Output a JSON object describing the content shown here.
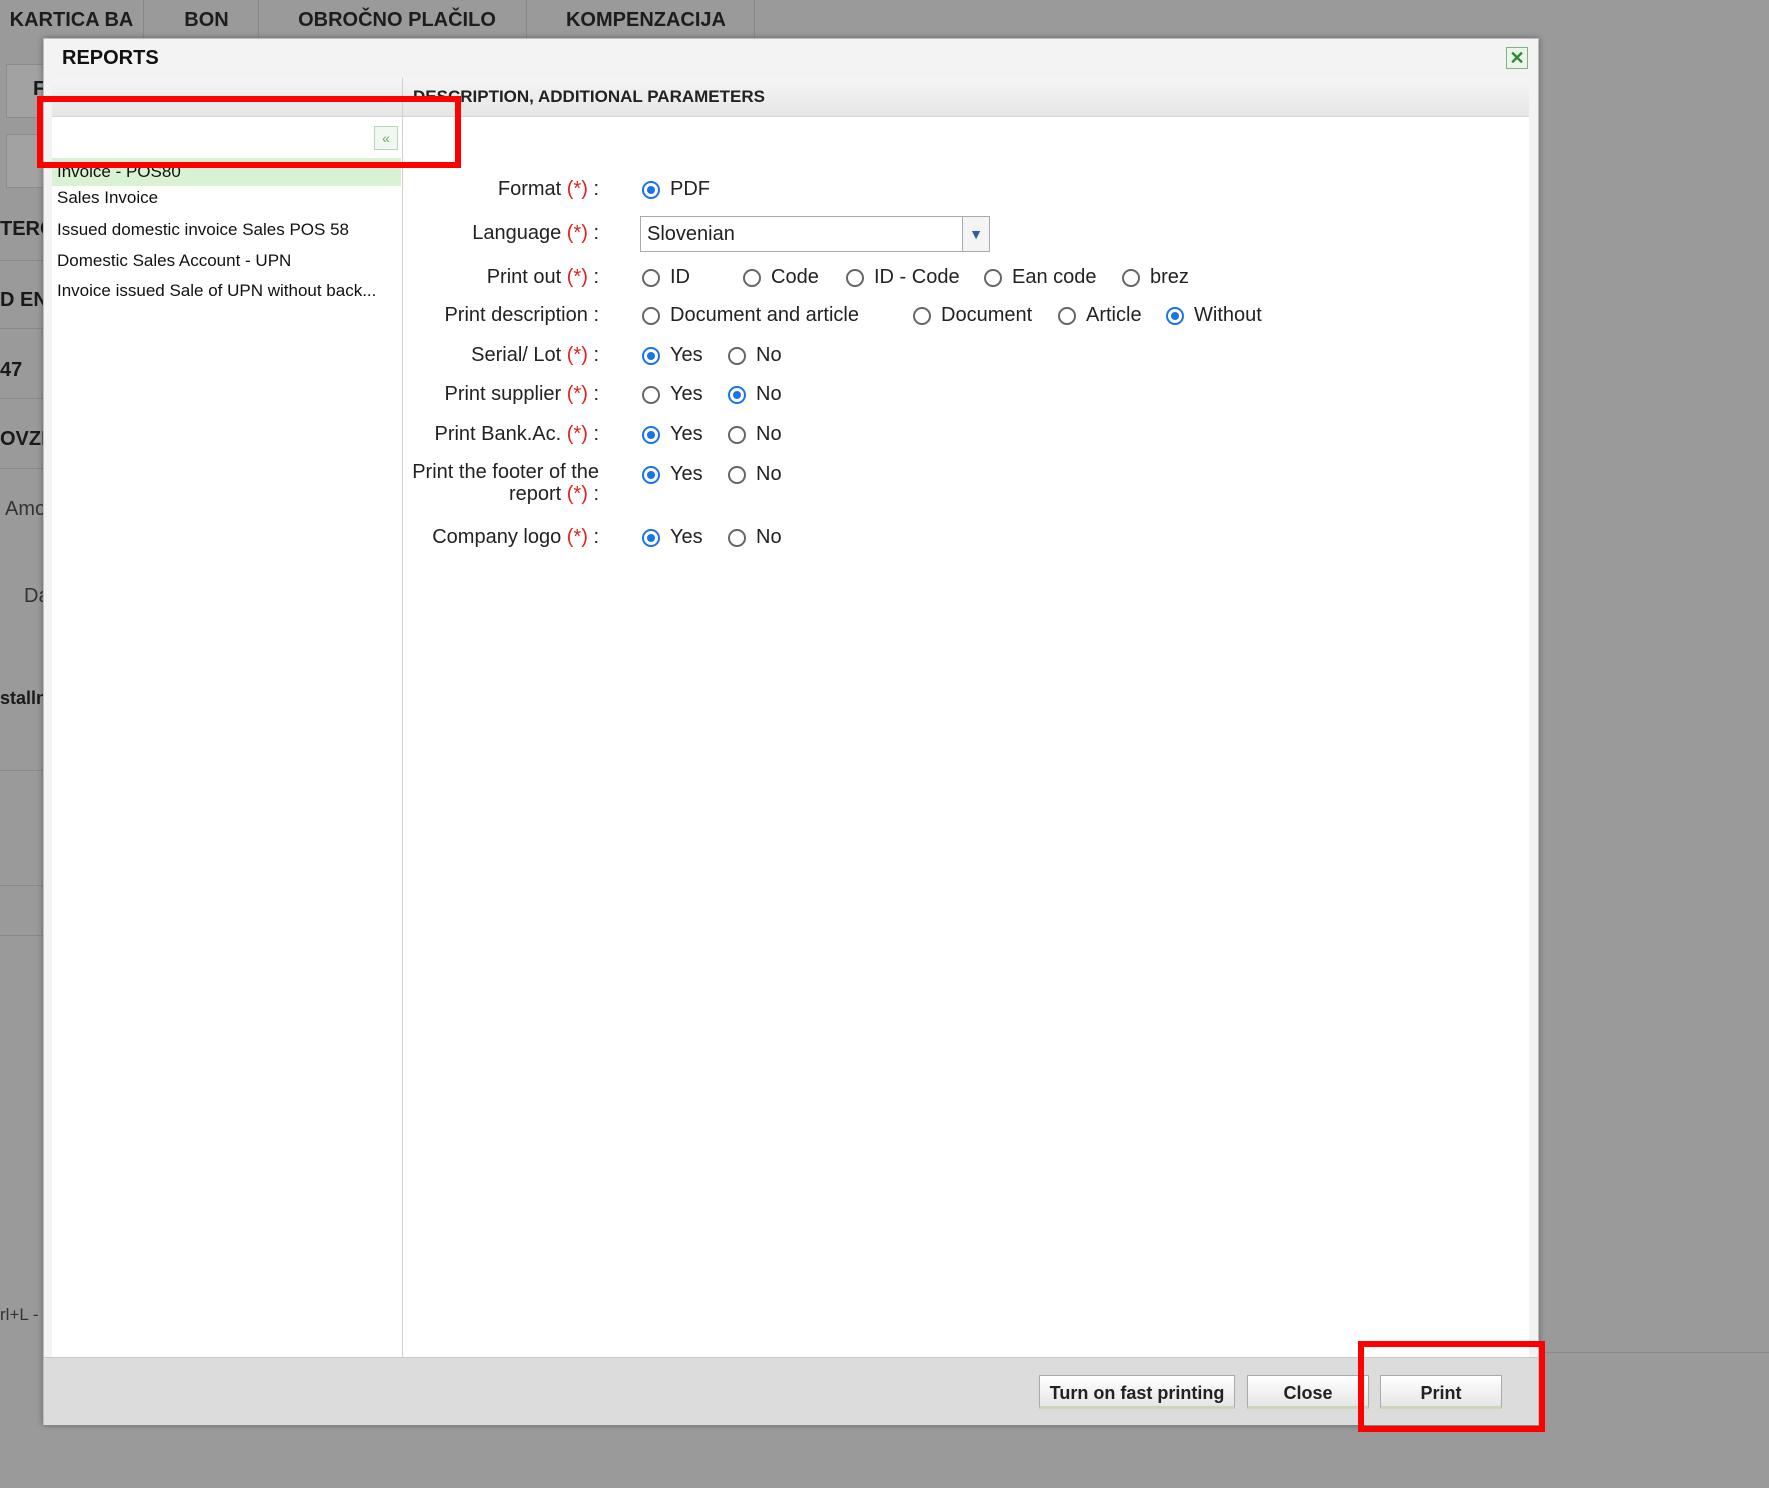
{
  "background": {
    "tabs": [
      "KARTICA BA",
      "BON",
      "OBROČNO PLAČILO",
      "KOMPENZACIJA"
    ],
    "fragments": [
      "F",
      "TERC",
      "D EN",
      "47",
      "OVZE",
      "Amo",
      "Da",
      "stalln",
      "rl+L -"
    ]
  },
  "dialog": {
    "title": "REPORTS",
    "close_symbol": "✕",
    "collapse_symbol": "«",
    "reports": [
      "Invoice - POS80",
      "Sales Invoice",
      "Issued domestic invoice Sales POS 58",
      "Domestic Sales Account - UPN",
      "Invoice issued Sale of UPN without back..."
    ],
    "selected_report_index": 0,
    "params_header": "DESCRIPTION, ADDITIONAL PARAMETERS",
    "required_mark": "(*)",
    "colon": ":",
    "fields": {
      "format": {
        "label": "Format",
        "options": [
          "PDF"
        ],
        "selected": 0
      },
      "language": {
        "label": "Language",
        "value": "Slovenian"
      },
      "print_out": {
        "label": "Print out",
        "options": [
          "ID",
          "Code",
          "ID - Code",
          "Ean code",
          "brez"
        ],
        "selected": -1
      },
      "print_description": {
        "label": "Print description",
        "options": [
          "Document and article",
          "Document",
          "Article",
          "Without"
        ],
        "selected": 3
      },
      "serial_lot": {
        "label": "Serial/ Lot",
        "options": [
          "Yes",
          "No"
        ],
        "selected": 0
      },
      "print_supplier": {
        "label": "Print supplier",
        "options": [
          "Yes",
          "No"
        ],
        "selected": 1
      },
      "print_bank": {
        "label": "Print Bank.Ac.",
        "options": [
          "Yes",
          "No"
        ],
        "selected": 0
      },
      "print_footer": {
        "label_line1": "Print the footer of the",
        "label_line2": "report",
        "options": [
          "Yes",
          "No"
        ],
        "selected": 0
      },
      "company_logo": {
        "label": "Company logo",
        "options": [
          "Yes",
          "No"
        ],
        "selected": 0
      }
    },
    "buttons": {
      "fast_printing": "Turn on fast printing",
      "close": "Close",
      "print": "Print"
    }
  },
  "colors": {
    "selected_row": "#d9f2d4",
    "required": "#e02020",
    "radio_on": "#1a73e8",
    "highlight": "#ff0000"
  }
}
